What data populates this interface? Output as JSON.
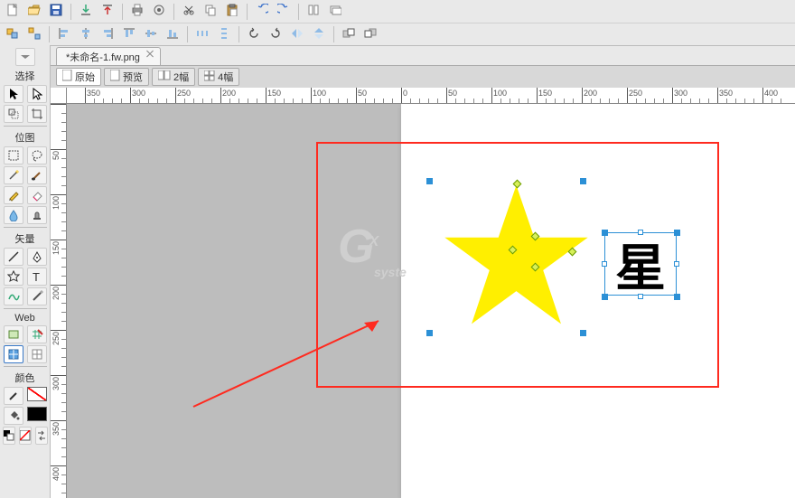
{
  "doc_tab": {
    "title": "*未命名-1.fw.png"
  },
  "view_tabs": {
    "original": "原始",
    "preview": "预览",
    "two_up": "2幅",
    "four_up": "4幅"
  },
  "palette": {
    "select_label": "选择",
    "bitmap_label": "位图",
    "vector_label": "矢量",
    "web_label": "Web",
    "colors_label": "颜色"
  },
  "ruler": {
    "h_labels": [
      "350",
      "300",
      "250",
      "200",
      "150",
      "100",
      "50",
      "0",
      "50",
      "100",
      "150",
      "200",
      "250",
      "300",
      "350",
      "400"
    ],
    "v_labels": [
      "50",
      "100",
      "150",
      "200",
      "250",
      "300",
      "350",
      "400"
    ]
  },
  "canvas": {
    "text_value": "星"
  },
  "watermark": {
    "main": "G",
    "sup": "X",
    "sub": "syste"
  },
  "colors": {
    "star_fill": "#ffef00",
    "selection": "#2c90d6",
    "annotation": "#ff2a1f"
  }
}
